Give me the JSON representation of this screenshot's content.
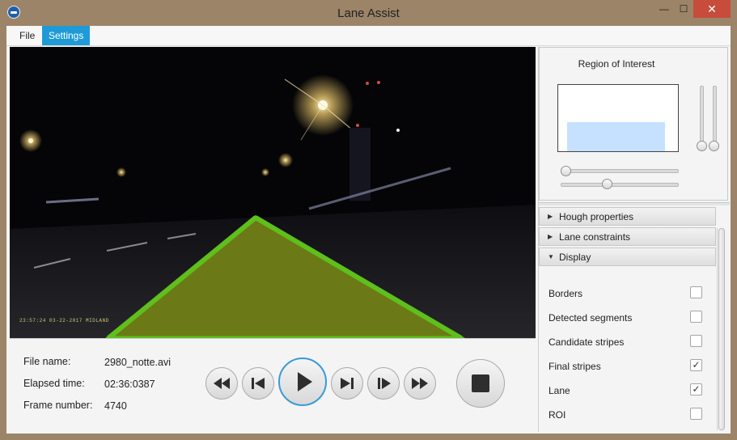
{
  "window": {
    "title": "Lane Assist",
    "controls": {
      "minimize": "—",
      "maximize": "☐",
      "close": "✕"
    }
  },
  "menu": {
    "items": [
      "File",
      "Settings"
    ],
    "active": "Settings"
  },
  "video": {
    "overlay_color": "#6b7a16",
    "lane_border_color": "#5fbf1c",
    "timestamp": "23:57:24   03-22-2017    MIDLAND"
  },
  "file_info": {
    "file_name_label": "File name:",
    "file_name_value": "2980_notte.avi",
    "elapsed_label": "Elapsed time:",
    "elapsed_value": "02:36:0387",
    "frame_label": "Frame number:",
    "frame_value": "4740"
  },
  "playback": {
    "buttons": [
      "fast-rewind-icon",
      "skip-previous-icon",
      "play-icon",
      "skip-next-icon",
      "step-forward-icon",
      "fast-forward-icon",
      "stop-icon"
    ],
    "accent": "#3a9ad9"
  },
  "roi": {
    "title": "Region of Interest",
    "rect_color": "#c5e1ff"
  },
  "accordion": {
    "sections": [
      {
        "label": "Hough properties",
        "expanded": false
      },
      {
        "label": "Lane constraints",
        "expanded": false
      },
      {
        "label": "Display",
        "expanded": true
      }
    ],
    "display_options": [
      {
        "label": "Borders",
        "checked": false
      },
      {
        "label": "Detected segments",
        "checked": false
      },
      {
        "label": "Candidate stripes",
        "checked": false
      },
      {
        "label": "Final stripes",
        "checked": true
      },
      {
        "label": "Lane",
        "checked": true
      },
      {
        "label": "ROI",
        "checked": false
      }
    ]
  }
}
